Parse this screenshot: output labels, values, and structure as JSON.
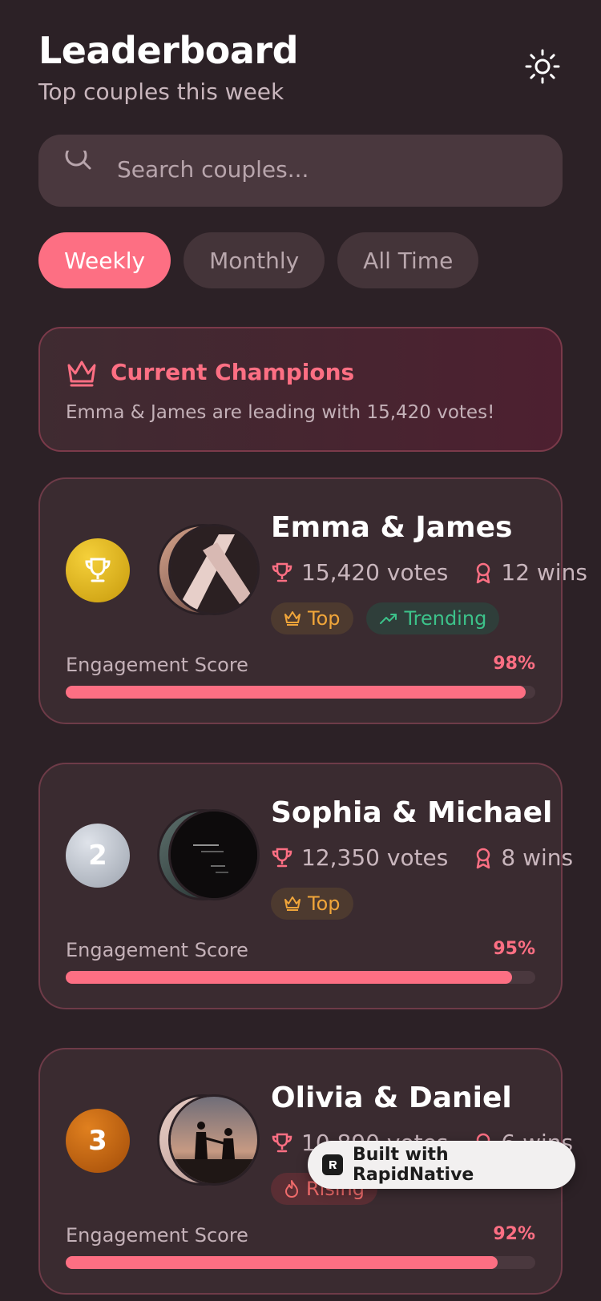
{
  "header": {
    "title": "Leaderboard",
    "subtitle": "Top couples this week",
    "theme_icon": "sun-icon"
  },
  "search": {
    "placeholder": "Search couples..."
  },
  "tabs": [
    {
      "label": "Weekly",
      "active": true
    },
    {
      "label": "Monthly",
      "active": false
    },
    {
      "label": "All Time",
      "active": false
    }
  ],
  "champions": {
    "heading": "Current Champions",
    "message": "Emma & James are leading with 15,420 votes!"
  },
  "couples": [
    {
      "rank": "",
      "rank_icon": "trophy-icon",
      "name": "Emma & James",
      "votes": "15,420 votes",
      "wins": "12 wins",
      "badges": [
        "Top",
        "Trending"
      ],
      "engagement_label": "Engagement Score",
      "engagement": "98%",
      "engagement_value": 98
    },
    {
      "rank": "2",
      "name": "Sophia & Michael",
      "votes": "12,350 votes",
      "wins": "8 wins",
      "badges": [
        "Top"
      ],
      "engagement_label": "Engagement Score",
      "engagement": "95%",
      "engagement_value": 95
    },
    {
      "rank": "3",
      "name": "Olivia & Daniel",
      "votes": "10,890 votes",
      "wins": "6 wins",
      "badges": [
        "Rising"
      ],
      "engagement_label": "Engagement Score",
      "engagement": "92%",
      "engagement_value": 92
    }
  ],
  "built_with": "Built with RapidNative",
  "colors": {
    "accent": "#fd6f83",
    "background": "#2c2126",
    "gold": "#e8b817",
    "silver": "#b9bfc9",
    "bronze": "#c2640f"
  }
}
